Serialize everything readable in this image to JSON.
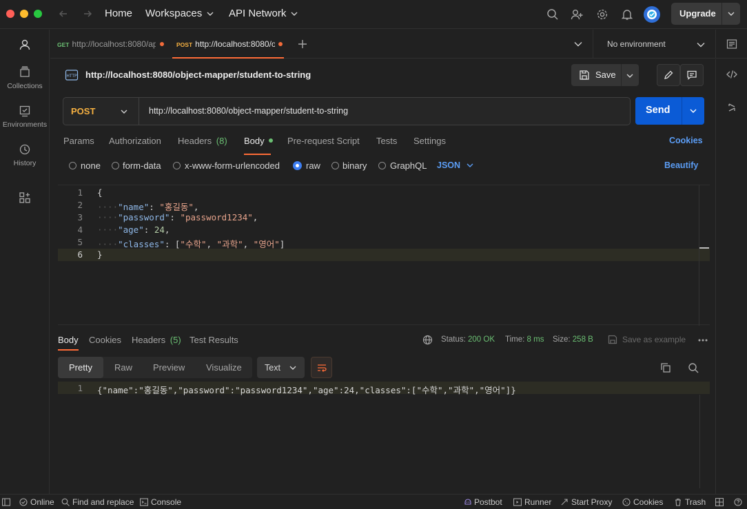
{
  "titlebar": {
    "home": "Home",
    "workspaces": "Workspaces",
    "api_network": "API Network",
    "upgrade": "Upgrade"
  },
  "sidebar": {
    "items": [
      {
        "label": "Collections",
        "icon": "collections-icon"
      },
      {
        "label": "Environments",
        "icon": "environments-icon"
      },
      {
        "label": "History",
        "icon": "history-icon"
      }
    ]
  },
  "tabs": [
    {
      "method": "GET",
      "title": "http://localhost:8080/ap"
    },
    {
      "method": "POST",
      "title": "http://localhost:8080/o"
    }
  ],
  "environment": "No environment",
  "request": {
    "name": "http://localhost:8080/object-mapper/student-to-string",
    "method": "POST",
    "url": "http://localhost:8080/object-mapper/student-to-string",
    "save": "Save",
    "send": "Send"
  },
  "req_tabs": {
    "params": "Params",
    "authorization": "Authorization",
    "headers": "Headers",
    "headers_count": "(8)",
    "body": "Body",
    "prerequest": "Pre-request Script",
    "tests": "Tests",
    "settings": "Settings",
    "cookies": "Cookies"
  },
  "body_modes": {
    "none": "none",
    "form_data": "form-data",
    "urlencoded": "x-www-form-urlencoded",
    "raw": "raw",
    "binary": "binary",
    "graphql": "GraphQL",
    "format": "JSON",
    "beautify": "Beautify"
  },
  "editor": {
    "line_numbers": [
      "1",
      "2",
      "3",
      "4",
      "5",
      "6"
    ],
    "open_brace": "{",
    "close_brace": "}",
    "key_name": "\"name\"",
    "val_name": "\"홍길동\"",
    "key_password": "\"password\"",
    "val_password": "\"password1234\"",
    "key_age": "\"age\"",
    "val_age": "24",
    "key_classes": "\"classes\"",
    "val_class_1": "\"수학\"",
    "val_class_2": "\"과학\"",
    "val_class_3": "\"영어\""
  },
  "response": {
    "tabs": {
      "body": "Body",
      "cookies": "Cookies",
      "headers": "Headers",
      "headers_count": "(5)",
      "test_results": "Test Results"
    },
    "status_label": "Status:",
    "status_value": "200 OK",
    "time_label": "Time:",
    "time_value": "8 ms",
    "size_label": "Size:",
    "size_value": "258 B",
    "save_example": "Save as example",
    "views": {
      "pretty": "Pretty",
      "raw": "Raw",
      "preview": "Preview",
      "visualize": "Visualize",
      "format": "Text"
    },
    "line_number": "1",
    "body_text": "{\"name\":\"홍길동\",\"password\":\"password1234\",\"age\":24,\"classes\":[\"수학\",\"과학\",\"영어\"]}"
  },
  "statusbar": {
    "online": "Online",
    "find_replace": "Find and replace",
    "console": "Console",
    "postbot": "Postbot",
    "runner": "Runner",
    "start_proxy": "Start Proxy",
    "cookies": "Cookies",
    "trash": "Trash"
  },
  "colors": {
    "accent_orange": "#ff6c37",
    "send_blue": "#0b5bd6",
    "link_blue": "#5b9df5",
    "status_green": "#6bbf73",
    "post_yellow": "#f5b041"
  }
}
